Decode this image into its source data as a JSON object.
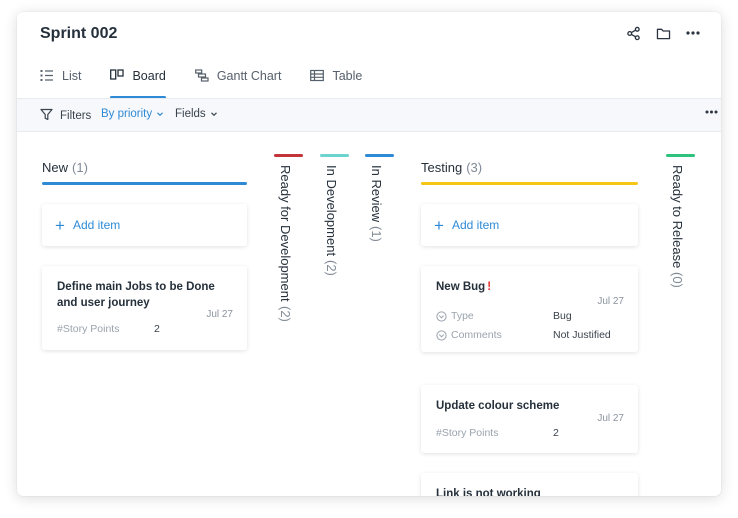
{
  "header": {
    "title": "Sprint 002"
  },
  "tabs": [
    {
      "label": "List",
      "icon": "list-icon"
    },
    {
      "label": "Board",
      "icon": "board-icon",
      "active": true
    },
    {
      "label": "Gantt Chart",
      "icon": "gantt-icon"
    },
    {
      "label": "Table",
      "icon": "table-icon"
    }
  ],
  "toolbar": {
    "filters": "Filters",
    "priority": "By priority",
    "fields": "Fields"
  },
  "columns": {
    "new": {
      "name": "New",
      "count": "(1)",
      "color": "#2f8ad6"
    },
    "ready_dev": {
      "name": "Ready for Development",
      "count": "(2)",
      "color": "#c0343a"
    },
    "in_dev": {
      "name": "In Development",
      "count": "(2)",
      "color": "#6dd3cf"
    },
    "in_review": {
      "name": "In Review",
      "count": "(1)",
      "color": "#2f8ad6"
    },
    "testing": {
      "name": "Testing",
      "count": "(3)",
      "color": "#f5c518"
    },
    "ready_release": {
      "name": "Ready to Release",
      "count": "(0)",
      "color": "#2ec27e"
    }
  },
  "add_item": "Add item",
  "tasks": {
    "t1": {
      "title_line1": "Define main Jobs to be Done",
      "title_line2": "and user journey",
      "date": "Jul 27",
      "field": "#Story Points",
      "value": "2"
    },
    "t2": {
      "title": "New Bug",
      "bang": "!",
      "date": "Jul 27",
      "type_label": "Type",
      "type_value": "Bug",
      "comments_label": "Comments",
      "comments_value": "Not Justified"
    },
    "t3": {
      "title": "Update colour scheme",
      "date": "Jul 27",
      "field": "#Story Points",
      "value": "2"
    },
    "t4": {
      "title": "Link is not working"
    }
  }
}
